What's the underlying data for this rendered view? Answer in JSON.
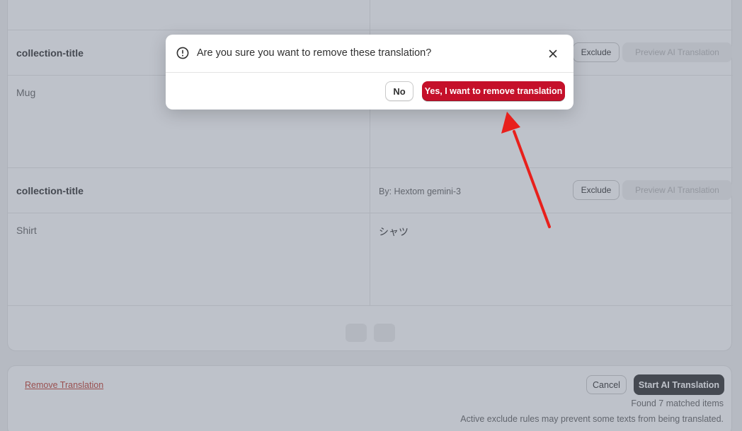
{
  "rows": [
    {
      "key": "collection-title",
      "by": "",
      "exclude_label": "Exclude",
      "preview_label": "Preview AI Translation",
      "source": "Mug",
      "translation": ""
    },
    {
      "key": "collection-title",
      "by": "By: Hextom gemini-3",
      "exclude_label": "Exclude",
      "preview_label": "Preview AI Translation",
      "source": "Shirt",
      "translation": "シャツ"
    }
  ],
  "footer": {
    "remove_link": "Remove Translation",
    "cancel_label": "Cancel",
    "start_label": "Start AI Translation",
    "found_text": "Found 7 matched items",
    "note_text": "Active exclude rules may prevent some texts from being translated."
  },
  "modal": {
    "title": "Are you sure you want to remove these translation?",
    "no_label": "No",
    "yes_label": "Yes, I want to remove translation",
    "icons": {
      "alert": "alert-circle-icon",
      "close": "close-icon"
    },
    "colors": {
      "danger": "#c5102a",
      "arrow": "#e8201c"
    }
  }
}
